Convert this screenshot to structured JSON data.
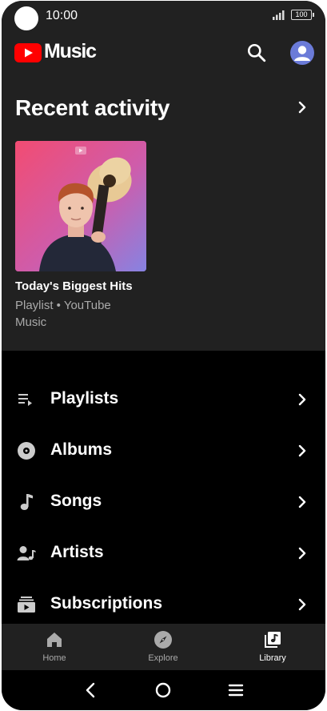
{
  "status_bar": {
    "time": "10:00",
    "battery": "100"
  },
  "header": {
    "logo_text": "Music",
    "logo_icon": "youtube-play-icon",
    "brand_color": "#ff0000"
  },
  "recent": {
    "title": "Recent activity",
    "card": {
      "title": "Today's Biggest Hits",
      "subtitle": "Playlist • YouTube Music"
    }
  },
  "library": {
    "items": [
      {
        "label": "Playlists",
        "icon": "playlist-icon"
      },
      {
        "label": "Albums",
        "icon": "album-icon"
      },
      {
        "label": "Songs",
        "icon": "music-note-icon"
      },
      {
        "label": "Artists",
        "icon": "artist-icon"
      },
      {
        "label": "Subscriptions",
        "icon": "subscriptions-icon"
      }
    ]
  },
  "bottom_nav": {
    "items": [
      {
        "label": "Home",
        "icon": "home-icon",
        "active": false
      },
      {
        "label": "Explore",
        "icon": "compass-icon",
        "active": false
      },
      {
        "label": "Library",
        "icon": "library-icon",
        "active": true
      }
    ]
  }
}
